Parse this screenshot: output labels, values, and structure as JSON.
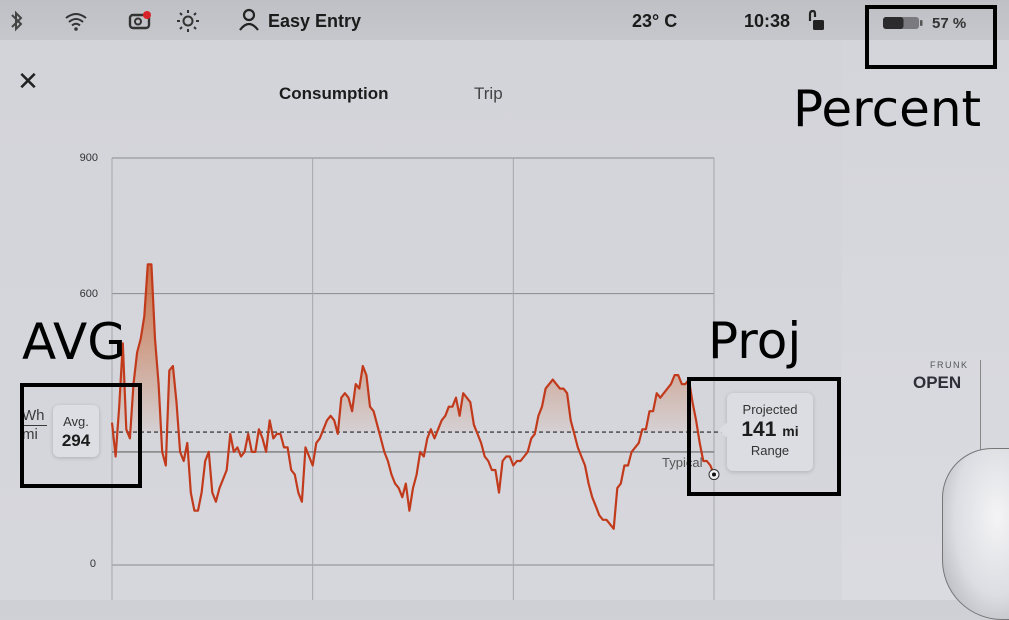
{
  "status_bar": {
    "icons": [
      "bluetooth-icon",
      "wifi-icon",
      "dashcam-icon",
      "brightness-icon"
    ],
    "profile_label": "Easy Entry",
    "temperature": "23° C",
    "time": "10:38",
    "lock_state": "unlocked",
    "battery_percent": "57 %",
    "battery_level": 0.57
  },
  "header": {
    "close_symbol": "✕",
    "tabs": [
      {
        "label": "Consumption",
        "active": true
      },
      {
        "label": "Trip",
        "active": false
      }
    ]
  },
  "chart": {
    "unit_top": "Wh",
    "unit_bottom": "mi",
    "avg_label": "Avg.",
    "avg_value": "294",
    "typical_label": "Typical",
    "projected_label": "Projected",
    "projected_value": "141",
    "projected_unit": "mi",
    "range_label": "Range",
    "accent_color": "#c23a1c"
  },
  "frunk": {
    "label": "FRUNK",
    "status": "OPEN"
  },
  "annotations": {
    "avg": "AVG",
    "proj": "Proj",
    "percent": "Percent"
  },
  "chart_data": {
    "type": "area",
    "title": "Consumption",
    "xlabel": "",
    "ylabel": "Wh/mi",
    "ylim": [
      0,
      900
    ],
    "yticks": [
      "900",
      "600",
      "0"
    ],
    "ytick_values": [
      900,
      600,
      0
    ],
    "reference_lines": [
      {
        "name": "Average",
        "value": 294,
        "style": "dashed"
      },
      {
        "name": "Typical",
        "value": 250,
        "style": "solid"
      }
    ],
    "x_gridlines": 3,
    "series": [
      {
        "name": "Consumption",
        "values": [
          315,
          240,
          350,
          490,
          300,
          280,
          400,
          470,
          500,
          550,
          665,
          665,
          500,
          400,
          250,
          220,
          430,
          440,
          360,
          250,
          230,
          270,
          160,
          120,
          120,
          160,
          230,
          250,
          160,
          140,
          170,
          190,
          210,
          290,
          250,
          260,
          240,
          250,
          290,
          250,
          250,
          300,
          280,
          250,
          320,
          280,
          290,
          290,
          260,
          260,
          210,
          200,
          160,
          140,
          260,
          240,
          220,
          270,
          280,
          300,
          320,
          330,
          320,
          290,
          370,
          380,
          370,
          340,
          400,
          390,
          440,
          420,
          350,
          340,
          310,
          280,
          250,
          230,
          200,
          180,
          170,
          150,
          180,
          120,
          170,
          200,
          250,
          240,
          280,
          300,
          280,
          300,
          320,
          330,
          350,
          350,
          370,
          330,
          380,
          370,
          360,
          310,
          290,
          270,
          240,
          230,
          210,
          210,
          160,
          230,
          240,
          240,
          220,
          230,
          230,
          240,
          250,
          280,
          290,
          330,
          350,
          390,
          400,
          410,
          400,
          390,
          390,
          380,
          320,
          290,
          260,
          240,
          220,
          180,
          150,
          130,
          110,
          100,
          100,
          90,
          80,
          170,
          180,
          220,
          220,
          250,
          260,
          270,
          300,
          300,
          340,
          340,
          380,
          370,
          380,
          390,
          400,
          420,
          420,
          400,
          400,
          410,
          360,
          320,
          270,
          230,
          230,
          220,
          200
        ]
      }
    ]
  }
}
